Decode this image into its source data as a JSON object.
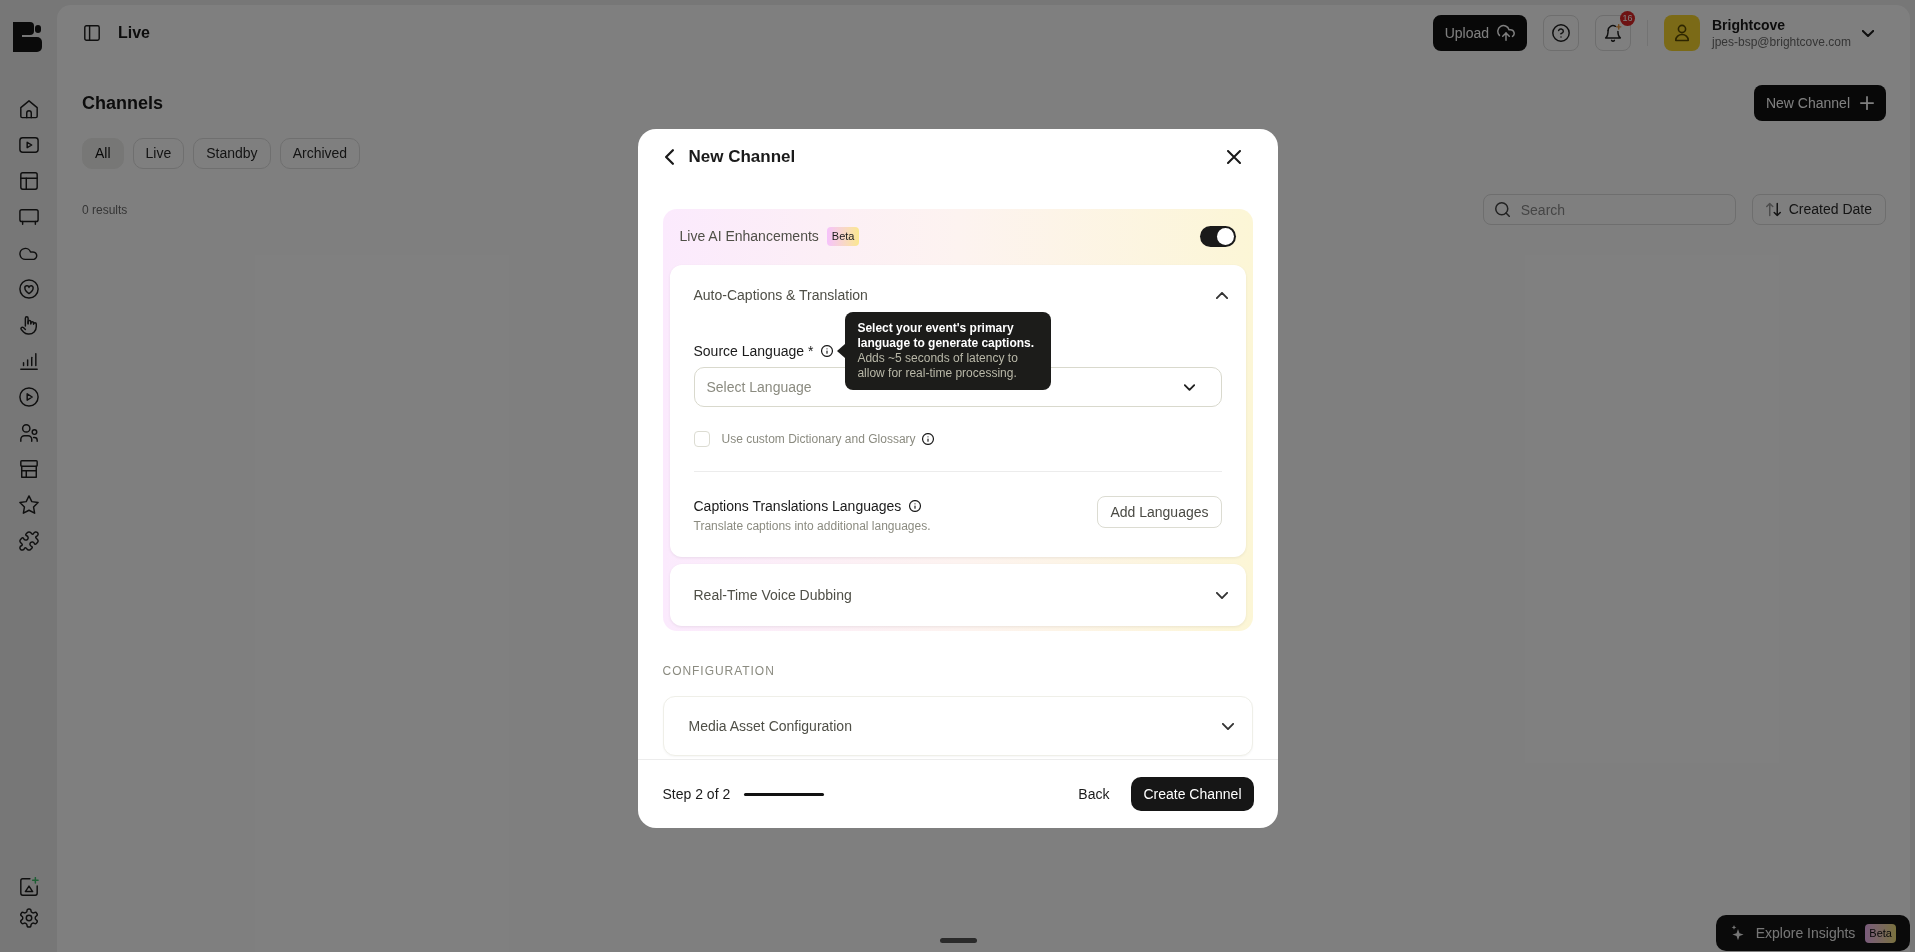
{
  "header": {
    "title": "Live",
    "upload_button": "Upload",
    "notification_count": "16",
    "account": {
      "name": "Brightcove",
      "email": "jpes-bsp@brightcove.com"
    }
  },
  "page": {
    "title": "Channels",
    "new_button": "New Channel",
    "filters": [
      {
        "label": "All",
        "selected": true
      },
      {
        "label": "Live",
        "selected": false
      },
      {
        "label": "Standby",
        "selected": false
      },
      {
        "label": "Archived",
        "selected": false
      }
    ],
    "results": "0 results",
    "search": {
      "placeholder": "Search"
    },
    "sort_button": "Created Date"
  },
  "modal": {
    "title": "New Channel",
    "ai_panel": {
      "title": "Live AI Enhancements",
      "badge": "Beta",
      "on": true,
      "sections": [
        {
          "title": "Auto-Captions & Translation",
          "expanded": true,
          "source_language": {
            "label": "Source Language *",
            "placeholder": "Select Language",
            "tooltip": {
              "title": "Select your event's primary language to generate captions.",
              "body": "Adds ~5 seconds of latency to allow for real-time processing."
            }
          },
          "custom_dictionary": {
            "label": "Use custom Dictionary and Glossary",
            "checked": false
          },
          "translations": {
            "title": "Captions Translations Languages",
            "description": "Translate captions into additional languages.",
            "button": "Add Languages"
          }
        },
        {
          "title": "Real-Time Voice Dubbing",
          "expanded": false
        }
      ]
    },
    "configuration": {
      "heading": "CONFIGURATION",
      "sections": [
        {
          "title": "Media Asset Configuration",
          "expanded": false
        }
      ]
    },
    "footer": {
      "step": "Step 2 of 2",
      "progress": {
        "level": 1
      },
      "back_button": "Back",
      "primary_button": "Create Channel"
    }
  },
  "insights_button": {
    "label": "Explore Insights",
    "badge": "Beta"
  }
}
